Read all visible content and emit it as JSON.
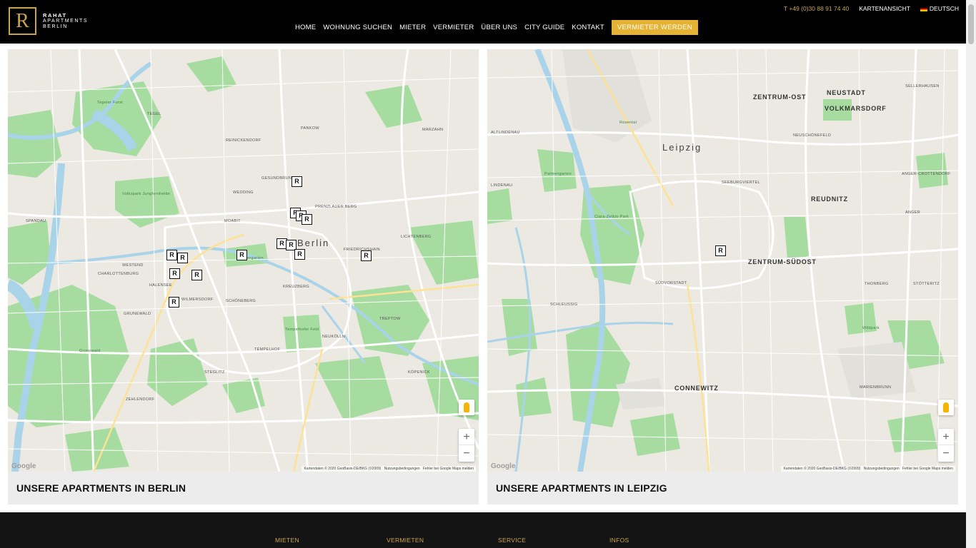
{
  "brand": {
    "line1": "RAHAT",
    "line2": "APARTMENTS",
    "line3": "BERLIN",
    "mark": "R"
  },
  "topbar": {
    "phone": "T +49 (0)30 88 91 74 40",
    "map_view": "KARTENANSICHT",
    "language": "DEUTSCH"
  },
  "nav": {
    "items": [
      "HOME",
      "WOHNUNG SUCHEN",
      "MIETER",
      "VERMIETER",
      "ÜBER UNS",
      "CITY GUIDE",
      "KONTAKT"
    ],
    "cta": "VERMIETER WERDEN"
  },
  "maps": {
    "berlin": {
      "title": "UNSERE APARTMENTS IN BERLIN",
      "city_label": "Berlin",
      "marker_count": 17,
      "labels": [
        "GESUNDBRUNNEN",
        "WEDDING",
        "MOABIT",
        "PRENZLAUER BERG",
        "FRIEDRICHSHAIN",
        "KREUZBERG",
        "SCHÖNEBERG",
        "WILMERSDORF",
        "CHARLOTTENBURG",
        "NEUKÖLLN",
        "TEMPELHOF",
        "STEGLITZ",
        "SPANDAU",
        "PANKOW",
        "REINICKENDORF",
        "LICHTENBERG",
        "TREPTOW",
        "GRUNEWALD",
        "HALENSEE",
        "ZEHLENDORF",
        "WESTEND",
        "TEGEL",
        "MARZAHN",
        "KÖPENICK"
      ],
      "parks": [
        "Tegeler Forst",
        "Tiergarten",
        "Tempelhofer Feld",
        "Volkspark Jungfernheide",
        "Grunewald"
      ],
      "attribution": "Kartendaten © 2020 GeoBasis-DE/BKG (©2009)",
      "terms": "Nutzungsbedingungen",
      "report": "Fehler bei Google Maps melden"
    },
    "leipzig": {
      "title": "UNSERE APARTMENTS IN LEIPZIG",
      "city_label": "Leipzig",
      "marker_count": 1,
      "labels": [
        "ZENTRUM-OST",
        "NEUSTADT",
        "VOLKMARSDORF",
        "SELLERHAUSEN",
        "ALTLINDENAU",
        "NEUSCHÖNEFELD",
        "SEEBURGVIERTEL",
        "REUDNITZ",
        "ANGER-CROTTENDORF",
        "ANGER",
        "LINDENAU",
        "ZENTRUM-SÜDOST",
        "SÜDVORSTADT",
        "THONBERG",
        "STÖTTERITZ",
        "SCHLEUSSIG",
        "CONNEWITZ",
        "MARIENBRUNN"
      ],
      "parks": [
        "Clara-Zetkin-Park",
        "Palmengarten",
        "Rosental",
        "Wildpark"
      ],
      "attribution": "Kartendaten © 2020 GeoBasis-DE/BKG (©2009)",
      "terms": "Nutzungsbedingungen",
      "report": "Fehler bei Google Maps melden"
    }
  },
  "footer": {
    "columns": [
      "MIETEN",
      "VERMIETEN",
      "SERVICE",
      "INFOS"
    ]
  },
  "colors": {
    "gold": "#c9a44c",
    "cta": "#e5b233",
    "header": "#000000",
    "footer": "#141414",
    "park": "#a7dca0",
    "water": "#a8d3e8"
  },
  "icons": {
    "pegman": "pegman-icon",
    "zoom_in": "plus-icon",
    "zoom_out": "minus-icon",
    "flag": "german-flag-icon"
  }
}
